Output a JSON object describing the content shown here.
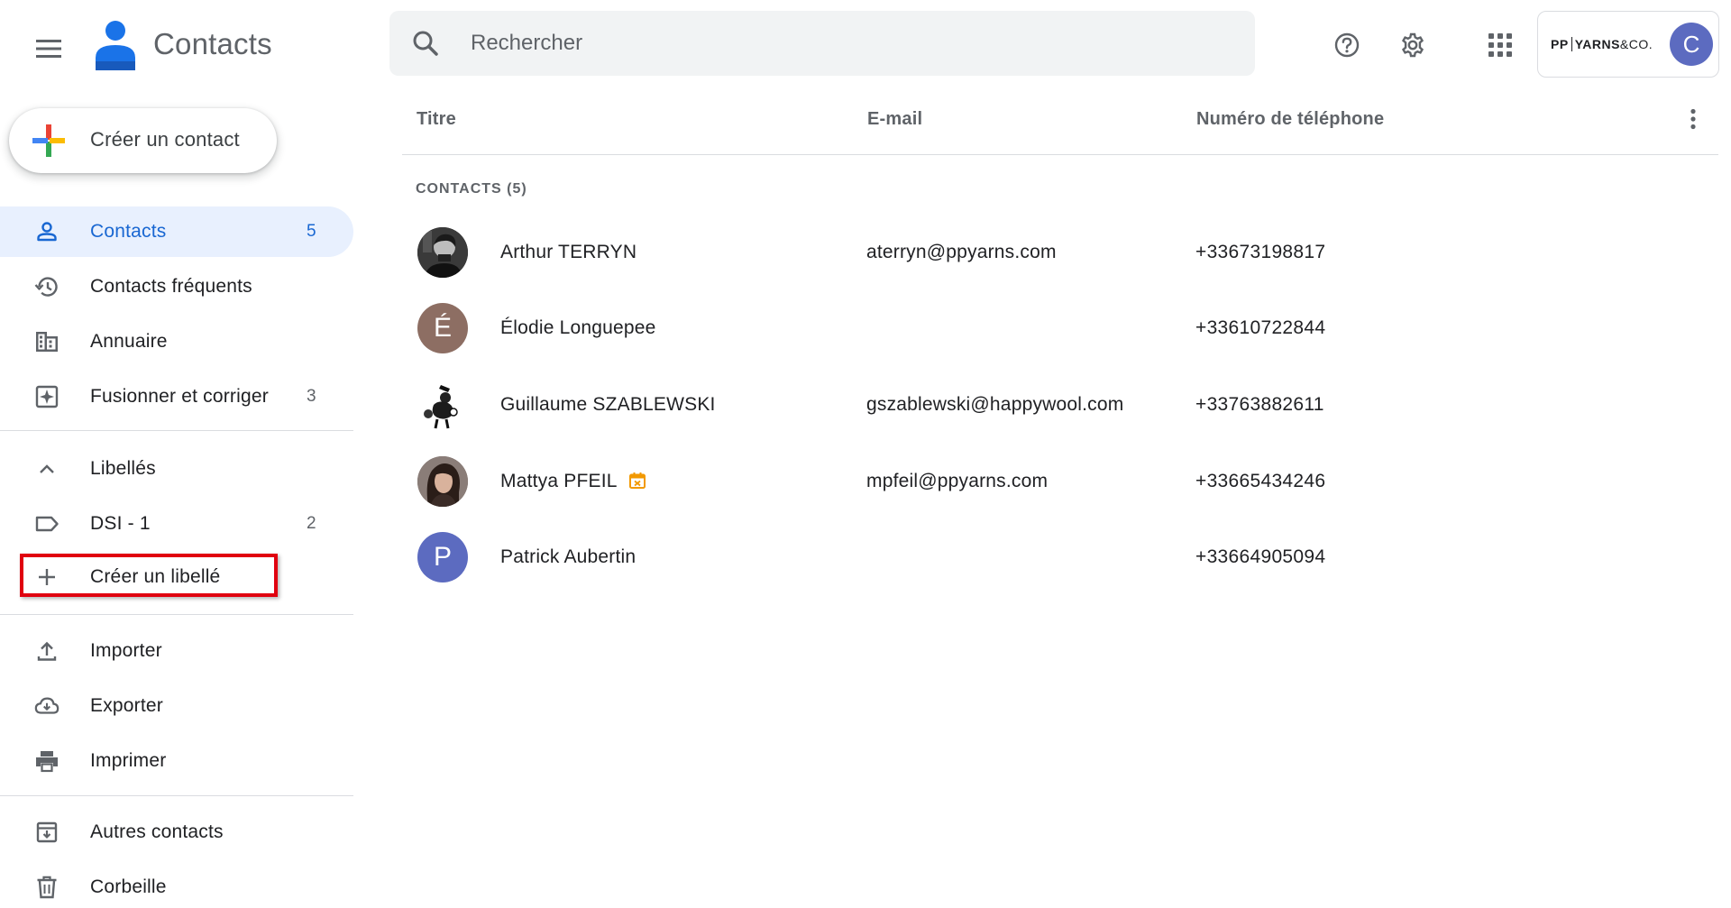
{
  "header": {
    "app_title": "Contacts",
    "search_placeholder": "Rechercher",
    "account": {
      "brand_pp": "PP",
      "brand_yarns": "YARNS",
      "brand_co": "&CO.",
      "avatar_letter": "C",
      "avatar_color": "#5c6bc0"
    }
  },
  "sidebar": {
    "create_contact": "Créer un contact",
    "items": [
      {
        "label": "Contacts",
        "count": "5",
        "icon": "person-icon",
        "active": true
      },
      {
        "label": "Contacts fréquents",
        "count": "",
        "icon": "history-icon"
      },
      {
        "label": "Annuaire",
        "count": "",
        "icon": "domain-icon"
      },
      {
        "label": "Fusionner et corriger",
        "count": "3",
        "icon": "merge-icon"
      }
    ],
    "labels_section": {
      "title": "Libellés",
      "labels": [
        {
          "label": "DSI - 1",
          "count": "2",
          "icon": "label-icon"
        }
      ],
      "create_label": "Créer un libellé"
    },
    "tools": [
      {
        "label": "Importer",
        "icon": "upload-icon"
      },
      {
        "label": "Exporter",
        "icon": "cloud-download-icon"
      },
      {
        "label": "Imprimer",
        "icon": "print-icon"
      }
    ],
    "other": [
      {
        "label": "Autres contacts",
        "icon": "archive-icon"
      },
      {
        "label": "Corbeille",
        "icon": "trash-icon"
      }
    ]
  },
  "table": {
    "columns": {
      "title": "Titre",
      "email": "E-mail",
      "phone": "Numéro de téléphone"
    },
    "section_label": "CONTACTS (5)",
    "rows": [
      {
        "name": "Arthur TERRYN",
        "email": "aterryn@ppyarns.com",
        "phone": "+33673198817",
        "avatar_type": "photo"
      },
      {
        "name": "Élodie Longuepee",
        "email": "",
        "phone": "+33610722844",
        "avatar_letter": "É",
        "avatar_color": "#8d6e63"
      },
      {
        "name": "Guillaume SZABLEWSKI",
        "email": "gszablewski@happywool.com",
        "phone": "+33763882611",
        "avatar_type": "photo"
      },
      {
        "name": "Mattya PFEIL",
        "email": "mpfeil@ppyarns.com",
        "phone": "+33665434246",
        "avatar_type": "photo",
        "badge_icon": "birthday-calendar-icon"
      },
      {
        "name": "Patrick Aubertin",
        "email": "",
        "phone": "+33664905094",
        "avatar_letter": "P",
        "avatar_color": "#5c6bc0"
      }
    ]
  },
  "colors": {
    "active_nav_bg": "#e8f0fe",
    "active_nav_text": "#1967d2",
    "highlight_box": "#e0000f",
    "search_bg": "#f1f3f4"
  }
}
